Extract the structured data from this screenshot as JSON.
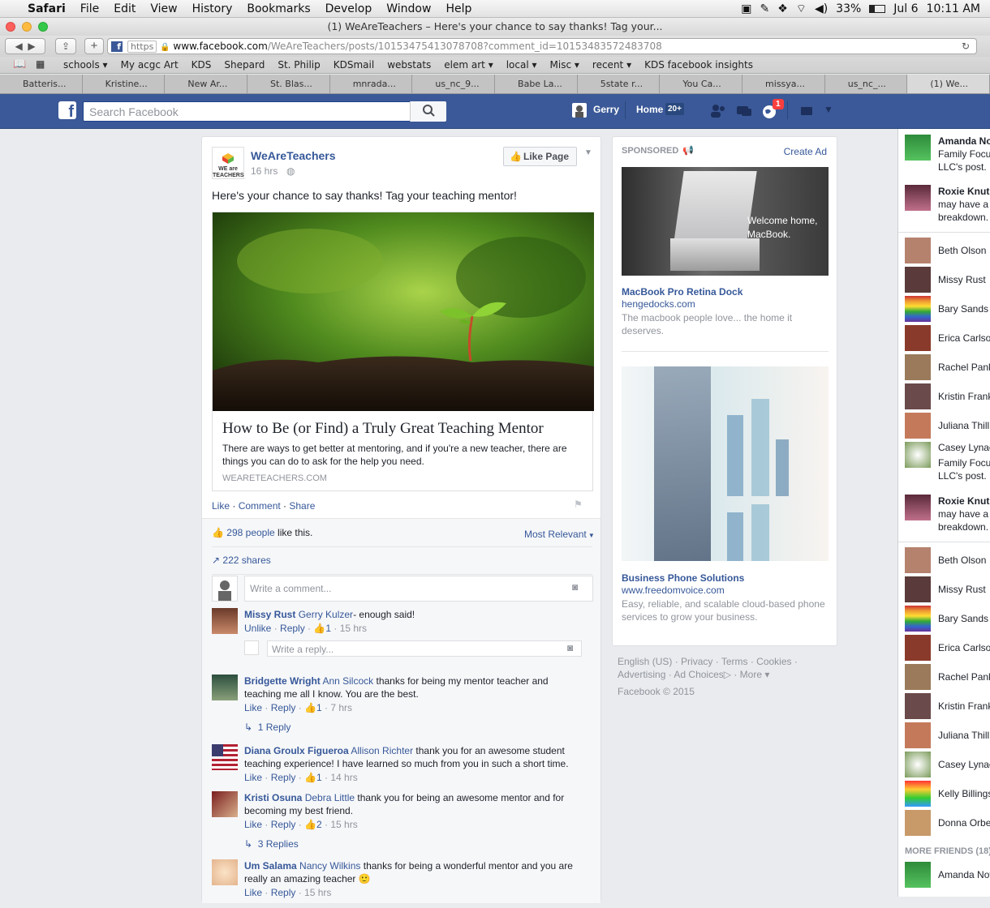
{
  "menubar": {
    "app": "Safari",
    "items": [
      "File",
      "Edit",
      "View",
      "History",
      "Bookmarks",
      "Develop",
      "Window",
      "Help"
    ],
    "battery": "33%",
    "date": "Jul 6",
    "time": "10:11 AM"
  },
  "window": {
    "title": "(1) WeAreTeachers – Here's your chance to say thanks! Tag your..."
  },
  "url": {
    "scheme": "https",
    "domain": "www.facebook.com",
    "path": "/WeAreTeachers/posts/10153475413078708?comment_id=10153483572483708"
  },
  "bookmarks": [
    "schools ▾",
    "My acgc Art",
    "KDS",
    "Shepard",
    "St. Philip",
    "KDSmail",
    "webstats",
    "elem art ▾",
    "local ▾",
    "Misc ▾",
    "recent ▾",
    "KDS facebook insights"
  ],
  "tabs": [
    "Batteris...",
    "Kristine...",
    "New Ar...",
    "St. Blas...",
    "mnrada...",
    "us_nc_9...",
    "Babe La...",
    "5state r...",
    "You Ca...",
    "missya...",
    "us_nc_...",
    "(1) We..."
  ],
  "fb": {
    "search_placeholder": "Search Facebook",
    "user": "Gerry",
    "home": "Home",
    "home_badge": "20+",
    "notif_badge": "1"
  },
  "post": {
    "page": "WeAreTeachers",
    "logo_text": "WE are TEACHERS",
    "time": "16 hrs",
    "like_page": "Like Page",
    "message": "Here's your chance to say thanks! Tag your teaching mentor!",
    "link_title": "How to Be (or Find) a Truly Great Teaching Mentor",
    "link_desc": "There are ways to get better at mentoring, and if you're a new teacher, there are things you can do to ask for the help you need.",
    "link_domain": "WEARETEACHERS.COM",
    "actions": [
      "Like",
      "Comment",
      "Share"
    ],
    "likes_count": "298 people",
    "likes_suffix": " like this.",
    "sort": "Most Relevant",
    "shares": "222 shares",
    "comment_placeholder": "Write a comment...",
    "reply_placeholder": "Write a reply..."
  },
  "comments": [
    {
      "author": "Missy Rust",
      "tag": "Gerry Kulzer",
      "text": "- enough said!",
      "actions": [
        "Unlike",
        "Reply"
      ],
      "likes": "1",
      "time": "15 hrs"
    },
    {
      "author": "Bridgette Wright",
      "tag": "Ann Silcock",
      "text": " thanks for being my mentor teacher and teaching me all I know. You are the best.",
      "actions": [
        "Like",
        "Reply"
      ],
      "likes": "1",
      "time": "7 hrs",
      "replies": "1 Reply"
    },
    {
      "author": "Diana Groulx Figueroa",
      "tag": "Allison Richter",
      "text": " thank you for an awesome student teaching experience! I have learned so much from you in such a short time.",
      "actions": [
        "Like",
        "Reply"
      ],
      "likes": "1",
      "time": "14 hrs"
    },
    {
      "author": "Kristi Osuna",
      "tag": "Debra Little",
      "text": " thank you for being an awesome mentor and for becoming my best friend.",
      "actions": [
        "Like",
        "Reply"
      ],
      "likes": "2",
      "time": "15 hrs",
      "replies": "3 Replies"
    },
    {
      "author": "Um Salama",
      "tag": "Nancy Wilkins",
      "text": " thanks for being a wonderful mentor and you are really an amazing teacher 🙂",
      "actions": [
        "Like",
        "Reply"
      ],
      "likes": "",
      "time": "15 hrs"
    }
  ],
  "ads": {
    "sponsored": "SPONSORED",
    "create_ad": "Create Ad",
    "ad1": {
      "image_caption": "Welcome home, MacBook.",
      "title": "MacBook Pro Retina Dock",
      "domain": "hengedocks.com",
      "desc": "The macbook people love... the home it deserves."
    },
    "ad2": {
      "title": "Business Phone Solutions",
      "domain": "www.freedomvoice.com",
      "desc": "Easy, reliable, and scalable cloud-based phone services to grow your business."
    }
  },
  "footer": {
    "links": [
      "English (US)",
      "Privacy",
      "Terms",
      "Cookies",
      "Advertising",
      "Ad Choices",
      "More"
    ],
    "copyright": "Facebook © 2015"
  },
  "chat": {
    "stories": [
      {
        "name": "Amanda No",
        "l1": "Family Focu",
        "l2": "LLC's post."
      },
      {
        "name": "Roxie Knuts",
        "l1": "may have a",
        "l2": "breakdown."
      }
    ],
    "friends1": [
      "Beth Olson",
      "Missy Rust",
      "Bary Sands",
      "Erica Carlso",
      "Rachel Pank",
      "Kristin Frank",
      "Juliana Thill",
      "Casey Lynae"
    ],
    "stories2": [
      {
        "l1": "Family Focu",
        "l2": "LLC's post."
      },
      {
        "name": "Roxie Knuts",
        "l1": "may have a",
        "l2": "breakdown."
      }
    ],
    "friends2": [
      "Beth Olson",
      "Missy Rust",
      "Bary Sands",
      "Erica Carlso",
      "Rachel Pank",
      "Kristin Frank",
      "Juliana Thill",
      "Casey Lynae",
      "Kelly Billings",
      "Donna Orbe"
    ],
    "more_label": "MORE FRIENDS (18)",
    "last": "Amanda Not"
  }
}
